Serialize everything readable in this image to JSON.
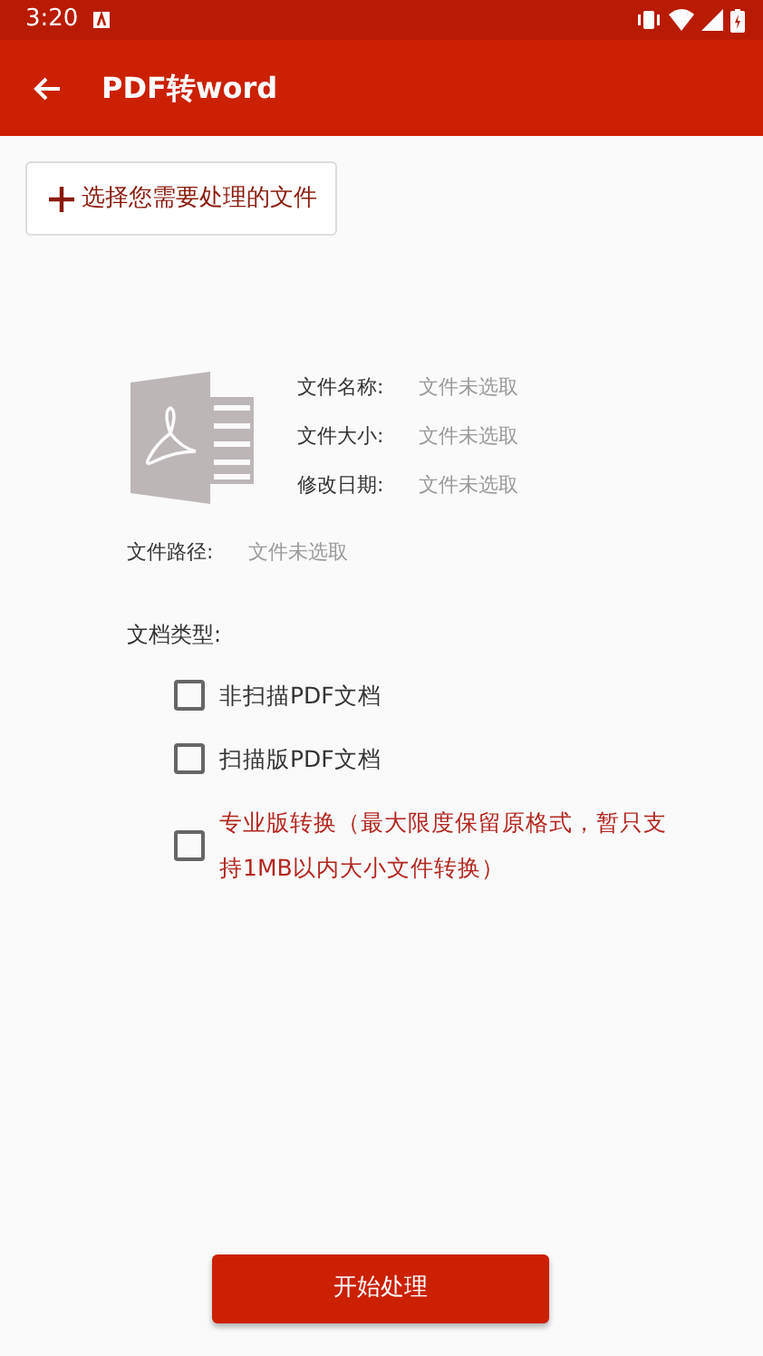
{
  "status_bar": {
    "time": "3:20"
  },
  "app_bar": {
    "title": "PDF转word"
  },
  "select_button": {
    "label": "选择您需要处理的文件"
  },
  "file_info": [
    {
      "label": "文件名称:",
      "value": "文件未选取"
    },
    {
      "label": "文件大小:",
      "value": "文件未选取"
    },
    {
      "label": "修改日期:",
      "value": "文件未选取"
    }
  ],
  "file_path": {
    "label": "文件路径:",
    "value": "文件未选取"
  },
  "doc_type": {
    "label": "文档类型:",
    "options": [
      {
        "label": "非扫描PDF文档",
        "checked": false,
        "highlight": false
      },
      {
        "label": "扫描版PDF文档",
        "checked": false,
        "highlight": false
      },
      {
        "label": "专业版转换（最大限度保留原格式，暂只支持1MB以内大小文件转换）",
        "checked": false,
        "highlight": true
      }
    ]
  },
  "start_button": {
    "label": "开始处理"
  }
}
